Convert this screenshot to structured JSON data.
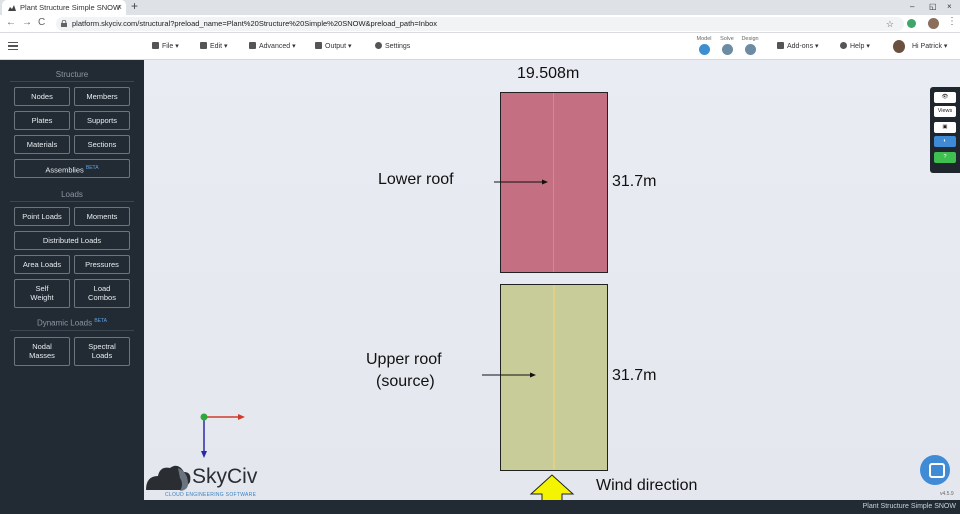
{
  "browser": {
    "tab_title": "Plant Structure Simple SNOW",
    "tab_close": "×",
    "new_tab": "+",
    "url": "platform.skyciv.com/structural?preload_name=Plant%20Structure%20Simple%20SNOW&preload_path=Inbox",
    "minimize": "–",
    "restore": "◱",
    "close": "×",
    "back": "←",
    "forward": "→",
    "reload": "C",
    "bookmark": "☆",
    "menu": "⋮"
  },
  "toolbar": {
    "file": "File ▾",
    "edit": "Edit ▾",
    "advanced": "Advanced ▾",
    "output": "Output ▾",
    "settings": "Settings",
    "modes": [
      "Model",
      "Solve",
      "Design"
    ],
    "addons": "Add-ons ▾",
    "help": "Help ▾",
    "user": "Hi Patrick ▾"
  },
  "sidebar": {
    "structure_title": "Structure",
    "structure_buttons": [
      "Nodes",
      "Members",
      "Plates",
      "Supports",
      "Materials",
      "Sections"
    ],
    "assemblies": "Assemblies",
    "beta": "BETA",
    "loads_title": "Loads",
    "point_loads": "Point Loads",
    "moments": "Moments",
    "distributed_loads": "Distributed Loads",
    "area_loads": "Area Loads",
    "pressures": "Pressures",
    "self_weight": [
      "Self",
      "Weight"
    ],
    "load_combos": [
      "Load",
      "Combos"
    ],
    "dynamic_title": "Dynamic Loads",
    "nodal_masses": [
      "Nodal",
      "Masses"
    ],
    "spectral_loads": [
      "Spectral",
      "Loads"
    ]
  },
  "canvas": {
    "width_dim": "19.508m",
    "lower_roof_label": "Lower roof",
    "lower_roof_dim": "31.7m",
    "upper_roof_label_1": "Upper roof",
    "upper_roof_label_2": "(source)",
    "upper_roof_dim": "31.7m",
    "wind_label": "Wind direction",
    "lower_roof_color": "#c46f82",
    "upper_roof_color": "#c7cc98",
    "wind_arrow_color": "#f4f400"
  },
  "right_tools": {
    "eye": "👁",
    "views": "Views",
    "camera": "▣",
    "settings": "◐",
    "help": "?"
  },
  "logo": {
    "name": "SkyCiv",
    "tagline": "CLOUD ENGINEERING SOFTWARE"
  },
  "status": {
    "project": "Plant Structure Simple SNOW",
    "version": "v4.5.9"
  }
}
